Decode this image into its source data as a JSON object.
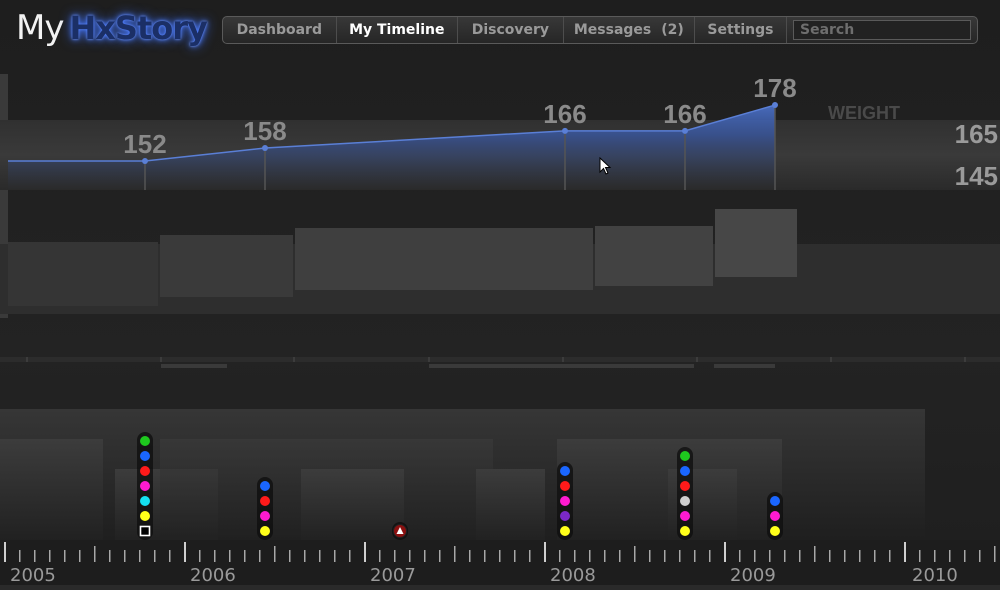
{
  "brand": {
    "my": "My",
    "name": "HxStory"
  },
  "nav": {
    "items": [
      {
        "label": "Dashboard",
        "active": false
      },
      {
        "label": "My Timeline",
        "active": true
      },
      {
        "label": "Discovery",
        "active": false
      },
      {
        "label": "Messages",
        "badge": "(2)",
        "active": false
      },
      {
        "label": "Settings",
        "active": false
      }
    ],
    "search_placeholder": "Search"
  },
  "colors": {
    "weight_fill": "#3d5ea8",
    "red": "#ff1a1a",
    "green": "#1ec81e",
    "blue": "#1a66ff",
    "magenta": "#ff1ad0",
    "cyan": "#14e0f0",
    "yellow": "#ffff1a",
    "purple": "#7a28c8",
    "gray": "#cfcfcf"
  },
  "chart_data": {
    "type": "area",
    "title": "WEIGHT",
    "x_axis": {
      "years": [
        "2005",
        "2006",
        "2007",
        "2008",
        "2009",
        "2010"
      ]
    },
    "y_axis": {
      "ticks": [
        "165",
        "145"
      ]
    },
    "series": [
      {
        "values": [
          {
            "date": "2005-10",
            "value": 152
          },
          {
            "date": "2006-06",
            "value": 158
          },
          {
            "date": "2008-02",
            "value": 166
          },
          {
            "date": "2008-10",
            "value": 166
          },
          {
            "date": "2009-04",
            "value": 178
          }
        ]
      }
    ],
    "event_stacks": [
      {
        "date": "2005-10",
        "icons": [
          "green",
          "blue",
          "red",
          "magenta",
          "cyan",
          "yellow",
          "empty-square"
        ]
      },
      {
        "date": "2006-06",
        "icons": [
          "blue",
          "red",
          "magenta",
          "yellow"
        ]
      },
      {
        "date": "2007-03",
        "icons": [
          "alert"
        ]
      },
      {
        "date": "2008-02",
        "icons": [
          "blue",
          "red",
          "magenta",
          "purple",
          "yellow"
        ]
      },
      {
        "date": "2008-10",
        "icons": [
          "green",
          "blue",
          "red",
          "gray",
          "magenta",
          "yellow"
        ]
      },
      {
        "date": "2009-04",
        "icons": [
          "blue",
          "magenta",
          "yellow"
        ]
      }
    ]
  }
}
